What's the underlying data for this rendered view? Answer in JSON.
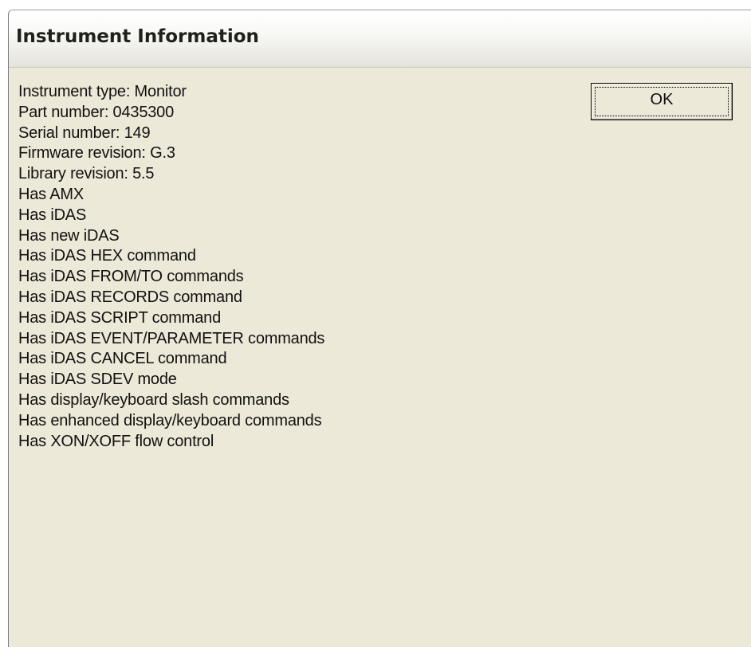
{
  "window": {
    "title": "Instrument Information"
  },
  "buttons": {
    "ok_label": "OK"
  },
  "info_lines": [
    "Instrument type: Monitor",
    "Part number: 0435300",
    "Serial number: 149",
    "Firmware revision: G.3",
    "Library revision: 5.5",
    "Has AMX",
    "Has iDAS",
    "Has new iDAS",
    "Has iDAS HEX command",
    "Has iDAS FROM/TO commands",
    "Has iDAS RECORDS command",
    "Has iDAS SCRIPT command",
    "Has iDAS EVENT/PARAMETER commands",
    "Has iDAS CANCEL command",
    "Has iDAS SDEV mode",
    "Has display/keyboard slash commands",
    "Has enhanced display/keyboard commands",
    "Has XON/XOFF flow control"
  ]
}
